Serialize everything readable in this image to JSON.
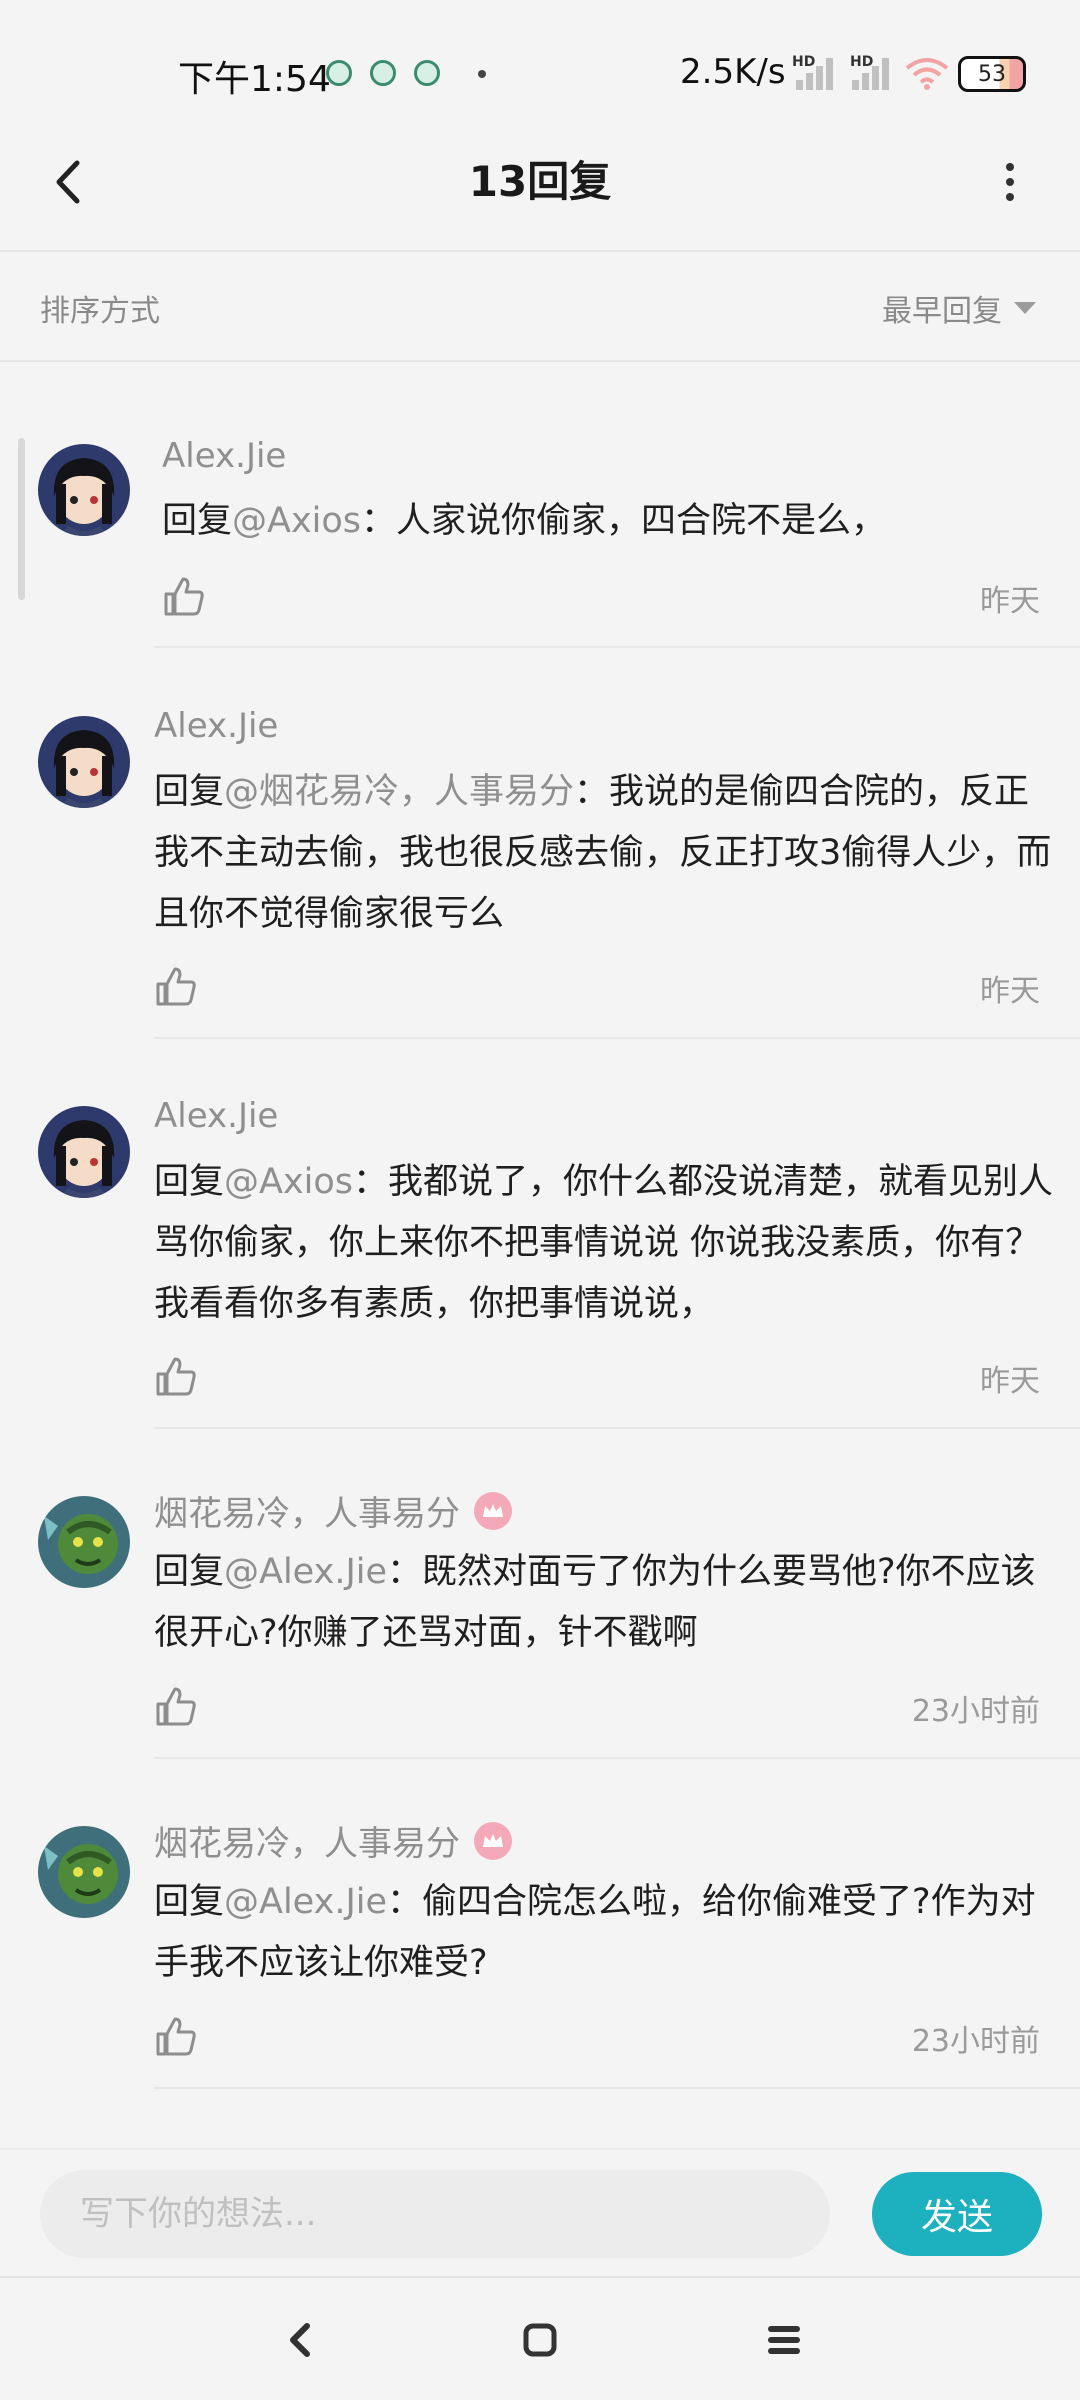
{
  "status_bar": {
    "time": "下午1:54",
    "network_speed": "2.5K/s",
    "signal_tag_1": "HD",
    "signal_tag_2": "HD",
    "battery": "53"
  },
  "header": {
    "title": "13回复",
    "back_icon": "back-arrow-icon",
    "more_icon": "more-vertical-icon"
  },
  "sort": {
    "label": "排序方式",
    "selected": "最早回复"
  },
  "replies": [
    {
      "username": "Alex.Jie",
      "prefix": "回复",
      "mention": "@Axios",
      "text": "：人家说你偷家，四合院不是么，",
      "time": "昨天",
      "avatar": "anime-dark-hair",
      "badge": false
    },
    {
      "username": "Alex.Jie",
      "prefix": "回复",
      "mention": "@烟花易冷，人事易分",
      "text": "：我说的是偷四合院的，反正我不主动去偷，我也很反感去偷，反正打攻3偷得人少，而且你不觉得偷家很亏么",
      "time": "昨天",
      "avatar": "anime-dark-hair",
      "badge": false
    },
    {
      "username": "Alex.Jie",
      "prefix": "回复",
      "mention": "@Axios",
      "text": "：我都说了，你什么都没说清楚，就看见别人骂你偷家，你上来你不把事情说说 你说我没素质，你有？我看看你多有素质，你把事情说说，",
      "time": "昨天",
      "avatar": "anime-dark-hair",
      "badge": false
    },
    {
      "username": "烟花易冷，人事易分",
      "prefix": "回复",
      "mention": "@Alex.Jie",
      "text": "：既然对面亏了你为什么要骂他?你不应该很开心?你赚了还骂对面，针不戳啊",
      "time": "23小时前",
      "avatar": "green-monster",
      "badge": true
    },
    {
      "username": "烟花易冷，人事易分",
      "prefix": "回复",
      "mention": "@Alex.Jie",
      "text": "：偷四合院怎么啦，给你偷难受了?作为对手我不应该让你难受?",
      "time": "23小时前",
      "avatar": "green-monster",
      "badge": true
    }
  ],
  "input": {
    "placeholder": "写下你的想法...",
    "send_label": "发送"
  },
  "colors": {
    "accent": "#1db0bf",
    "badge": "#f3a9b8",
    "secondary_text": "#8f8f8f"
  }
}
